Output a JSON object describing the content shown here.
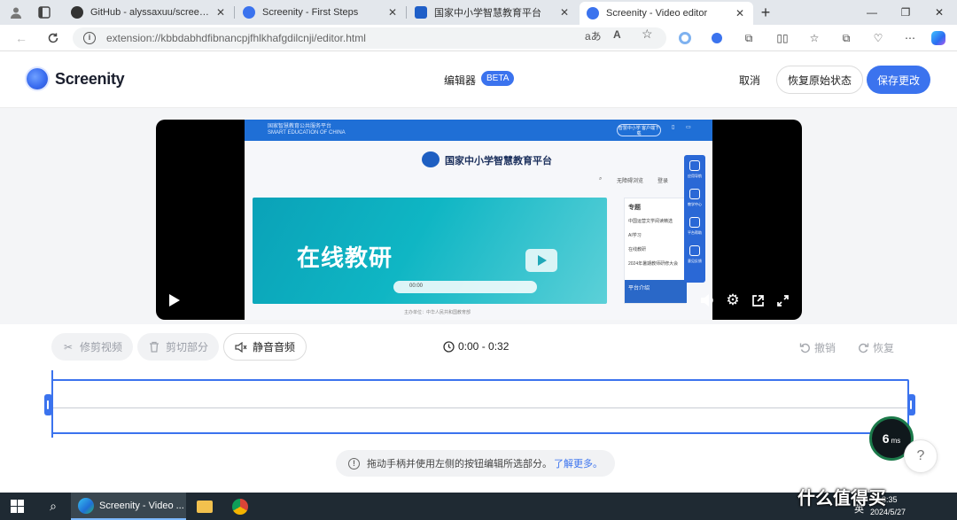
{
  "browser": {
    "tabs": [
      {
        "title": "GitHub - alyssaxuu/screenity: The",
        "active": false
      },
      {
        "title": "Screenity - First Steps",
        "active": false
      },
      {
        "title": "国家中小学智慧教育平台",
        "active": false
      },
      {
        "title": "Screenity - Video editor",
        "active": true
      }
    ],
    "url": "extension://kbbdabhdfibnancpjfhlkhafgdilcnji/editor.html",
    "read_aloud_label": "aあ",
    "font_label": "A"
  },
  "app": {
    "brand": "Screenity",
    "editor_label": "编辑器",
    "beta_badge": "BETA",
    "cancel": "取消",
    "revert": "恢复原始状态",
    "save": "保存更改",
    "accent": "#3b73ee"
  },
  "video_frame": {
    "site_top": "国家智慧教育公共服务平台",
    "site_top_en": "SMART EDUCATION OF CHINA",
    "app_pill": "智慧中小学\n客户端下载",
    "site_title": "国家中小学智慧教育平台",
    "nav_1": "无障碍浏览",
    "nav_2": "登录",
    "banner_text": "在线教研",
    "side_title": "专题",
    "side_items": [
      "中国运营文学阅读精选",
      "AI学习",
      "在线教研",
      "2024年暑期教师研修大会"
    ],
    "side_footer": "平台介绍",
    "rail_labels": [
      "应用导航",
      "教学中心",
      "平台帮助",
      "意见反馈"
    ],
    "toolbar_time": "00:00",
    "caption": "主办单位：中华人民共和国教育部"
  },
  "tools": {
    "trim": "修剪视频",
    "cut": "剪切部分",
    "mute": "静音音频",
    "time_range": "0:00 - 0:32",
    "undo": "撤销",
    "redo": "恢复"
  },
  "timeline": {
    "hint": "拖动手柄并使用左侧的按钮编辑所选部分。",
    "learn_more": "了解更多。"
  },
  "latency": {
    "value": "6",
    "unit": "ms"
  },
  "help": "?",
  "taskbar": {
    "edge_label": "Screenity - Video ...",
    "time": "18:35",
    "date": "2024/5/27",
    "ime": "英"
  },
  "watermark": "什么值得买"
}
